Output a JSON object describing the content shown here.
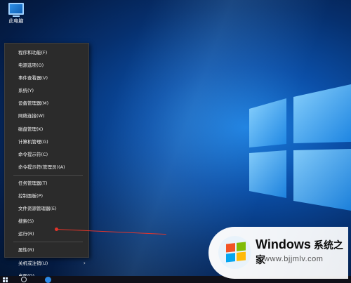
{
  "desktop": {
    "icon_label": "此电脑"
  },
  "context_menu": {
    "group1": [
      {
        "label": "程序和功能(F)"
      },
      {
        "label": "电源选项(O)"
      },
      {
        "label": "事件查看器(V)"
      },
      {
        "label": "系统(Y)"
      },
      {
        "label": "设备管理器(M)"
      },
      {
        "label": "网络连接(W)"
      },
      {
        "label": "磁盘管理(K)"
      },
      {
        "label": "计算机管理(G)"
      },
      {
        "label": "命令提示符(C)"
      },
      {
        "label": "命令提示符(管理员)(A)"
      }
    ],
    "group2": [
      {
        "label": "任务管理器(T)"
      },
      {
        "label": "控制面板(P)"
      },
      {
        "label": "文件资源管理器(E)"
      },
      {
        "label": "搜索(S)"
      },
      {
        "label": "运行(R)"
      }
    ],
    "group3": [
      {
        "label": "属性(R)"
      },
      {
        "label": "关机或注销(U)",
        "has_submenu": true
      },
      {
        "label": "桌面(D)"
      }
    ],
    "submenu_arrow": "›"
  },
  "watermark": {
    "title": "Windows",
    "title_cn": "系统之家",
    "url": "www.bjjmlv.com"
  },
  "colors": {
    "menu_bg": "#2b2b2b",
    "annotation": "#e2352b"
  }
}
